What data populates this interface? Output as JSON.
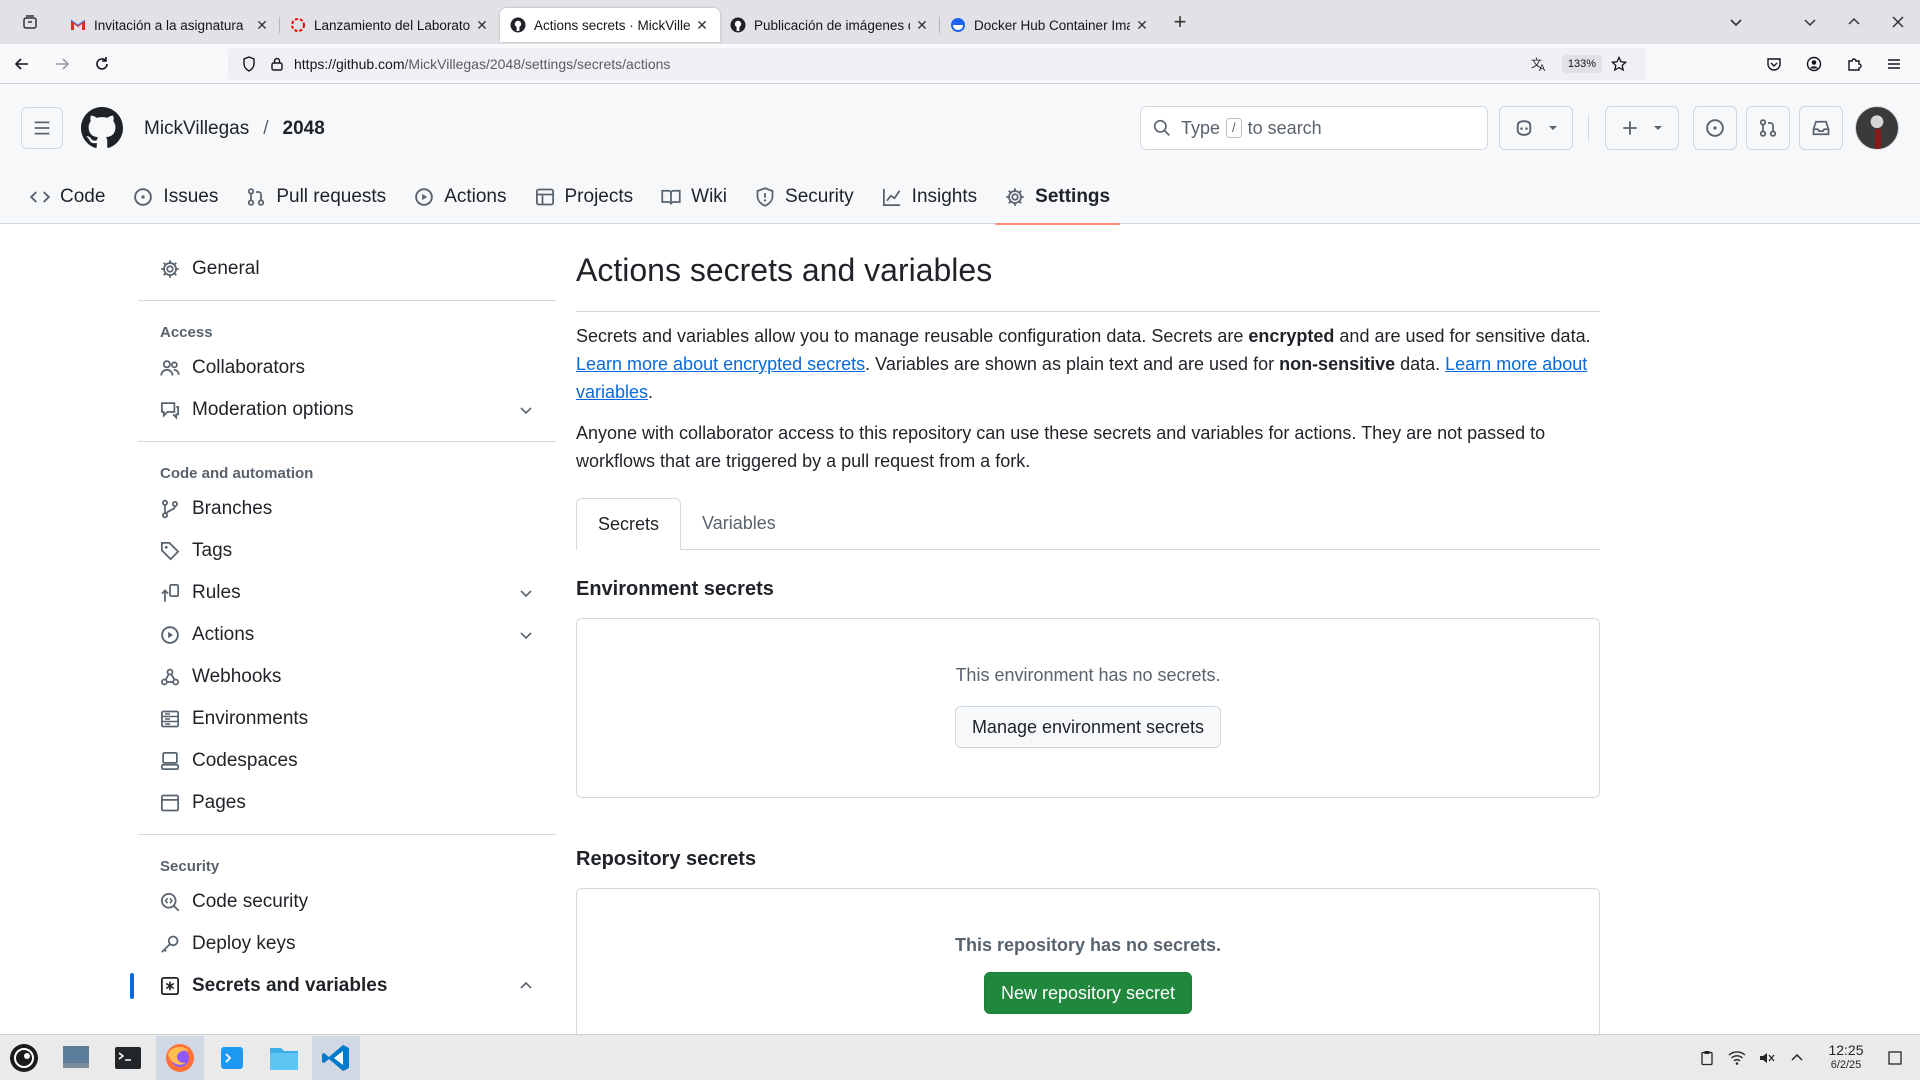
{
  "browser": {
    "tabs": [
      {
        "title": "Invitación a la asignatura",
        "favicon": "gmail-icon",
        "active": false
      },
      {
        "title": "Lanzamiento del Laborato",
        "favicon": "redhat-icon",
        "active": false
      },
      {
        "title": "Actions secrets · MickVilleg",
        "favicon": "github-icon",
        "active": true
      },
      {
        "title": "Publicación de imágenes d",
        "favicon": "github-icon",
        "active": false
      },
      {
        "title": "Docker Hub Container Ima",
        "favicon": "docker-icon",
        "active": false
      }
    ],
    "url_host": "https://github.com",
    "url_path": "/MickVillegas/2048/settings/secrets/actions",
    "zoom": "133%"
  },
  "github": {
    "owner": "MickVillegas",
    "repo": "2048",
    "search": {
      "prefix": "Type",
      "key": "/",
      "suffix": "to search"
    },
    "repo_nav": [
      {
        "label": "Code",
        "icon": "code-icon"
      },
      {
        "label": "Issues",
        "icon": "issue-icon"
      },
      {
        "label": "Pull requests",
        "icon": "pull-request-icon"
      },
      {
        "label": "Actions",
        "icon": "play-icon"
      },
      {
        "label": "Projects",
        "icon": "table-icon"
      },
      {
        "label": "Wiki",
        "icon": "book-icon"
      },
      {
        "label": "Security",
        "icon": "shield-icon"
      },
      {
        "label": "Insights",
        "icon": "graph-icon"
      },
      {
        "label": "Settings",
        "icon": "gear-icon",
        "selected": true
      }
    ]
  },
  "sidebar": {
    "general": "General",
    "access_heading": "Access",
    "access_items": [
      {
        "label": "Collaborators",
        "icon": "people-icon"
      },
      {
        "label": "Moderation options",
        "icon": "comment-icon"
      }
    ],
    "code_heading": "Code and automation",
    "code_items": [
      {
        "label": "Branches",
        "icon": "branch-icon"
      },
      {
        "label": "Tags",
        "icon": "tag-icon"
      },
      {
        "label": "Rules",
        "icon": "rules-icon"
      },
      {
        "label": "Actions",
        "icon": "play-icon"
      },
      {
        "label": "Webhooks",
        "icon": "webhook-icon"
      },
      {
        "label": "Environments",
        "icon": "server-icon"
      },
      {
        "label": "Codespaces",
        "icon": "codespaces-icon"
      },
      {
        "label": "Pages",
        "icon": "browser-icon"
      }
    ],
    "security_heading": "Security",
    "security_items": [
      {
        "label": "Code security",
        "icon": "codescan-icon"
      },
      {
        "label": "Deploy keys",
        "icon": "key-icon"
      },
      {
        "label": "Secrets and variables",
        "icon": "asterisk-icon"
      }
    ]
  },
  "main": {
    "title": "Actions secrets and variables",
    "intro1_a": "Secrets and variables allow you to manage reusable configuration data. Secrets are ",
    "intro1_b": "encrypted",
    "intro1_c": " and are used for sensitive data. ",
    "intro1_link1": "Learn more about encrypted secrets",
    "intro1_d": ". Variables are shown as plain text and are used for ",
    "intro1_e": "non-sensitive",
    "intro1_f": " data. ",
    "intro1_link2": "Learn more about variables",
    "intro1_g": ".",
    "intro2": "Anyone with collaborator access to this repository can use these secrets and variables for actions. They are not passed to workflows that are triggered by a pull request from a fork.",
    "tabs": [
      "Secrets",
      "Variables"
    ],
    "env_title": "Environment secrets",
    "env_empty": "This environment has no secrets.",
    "env_button": "Manage environment secrets",
    "repo_title": "Repository secrets",
    "repo_empty": "This repository has no secrets.",
    "repo_button": "New repository secret"
  },
  "taskbar": {
    "time": "12:25",
    "date": "6/2/25"
  },
  "colors": {
    "link": "#0969da",
    "primary_button": "#1f883d",
    "selected_underline": "#fd8c73"
  }
}
